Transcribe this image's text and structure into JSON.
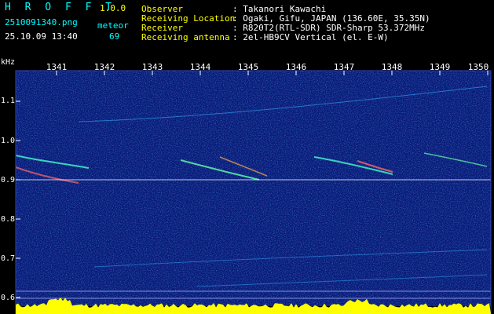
{
  "app": {
    "name": "H R O F F T",
    "version": "1.0.0"
  },
  "file": {
    "filename": "2510091340.png",
    "datetime": "25.10.09 13:40"
  },
  "counter": {
    "label": "meteor",
    "value": "69"
  },
  "info": [
    {
      "label": "Observer",
      "value": ": Takanori Kawachi"
    },
    {
      "label": "Receiving Location",
      "value": ": Ogaki, Gifu, JAPAN (136.60E, 35.35N)"
    },
    {
      "label": "Receiver",
      "value": ": R820T2(RTL-SDR) SDR-Sharp 53.372MHz"
    },
    {
      "label": "Receiving antenna",
      "value": ": 2el-HB9CV Vertical (el. E-W)"
    }
  ],
  "axis": {
    "y_unit": "kHz",
    "x_ticks": [
      "1341",
      "1342",
      "1343",
      "1344",
      "1345",
      "1346",
      "1347",
      "1348",
      "1349",
      "1350"
    ],
    "y_ticks": [
      "1.1",
      "1.0",
      "0.9",
      "0.8",
      "0.7",
      "0.6"
    ],
    "y_values": [
      1.1,
      1.0,
      0.9,
      0.8,
      0.7,
      0.6
    ]
  },
  "colors": {
    "background": "#000000",
    "spectrogram_base": "#0a1a7a",
    "header_text": "#00ffff",
    "accent_text": "#ffff00",
    "label_text": "#ffffff",
    "baseline_fill": "#ffff00"
  }
}
